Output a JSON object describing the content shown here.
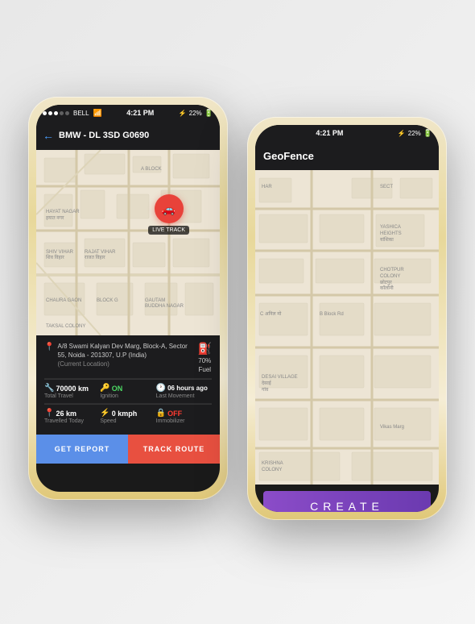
{
  "scene": {
    "background": "#f0f0f0"
  },
  "phone1": {
    "status_bar": {
      "carrier": "BELL",
      "signal_dots": [
        true,
        true,
        true,
        false,
        false
      ],
      "wifi": "wifi",
      "time": "4:21 PM",
      "bluetooth": "BT",
      "battery": "22%"
    },
    "nav": {
      "back_icon": "←",
      "title": "BMW - DL 3SD G0690"
    },
    "map": {
      "live_label": "LIVE TRACK",
      "marker_icon": "🚗"
    },
    "info": {
      "address": "A/8 Swami Kalyan Dev Marg, Block-A, Sector 55, Noida - 201307, U.P (India)",
      "location_label": "(Current Location)",
      "fuel_icon": "⛽",
      "fuel_value": "70%",
      "fuel_label": "Fuel"
    },
    "stats_row1": [
      {
        "icon": "🔧",
        "value": "70000 km",
        "label": "Total Travel"
      },
      {
        "icon": "🔑",
        "value": "ON",
        "label": "Ignition",
        "class": "on"
      },
      {
        "icon": "🕐",
        "value": "06 hours ago",
        "label": "Last Movement"
      }
    ],
    "stats_row2": [
      {
        "icon": "📍",
        "value": "26 km",
        "label": "Travelled Today"
      },
      {
        "icon": "⚡",
        "value": "0 kmph",
        "label": "Speed"
      },
      {
        "icon": "🔒",
        "value": "OFF",
        "label": "Immobilizer",
        "class": "off"
      }
    ],
    "buttons": {
      "report": "GET REPORT",
      "track": "TRACK ROUTE"
    }
  },
  "phone2": {
    "status_bar": {
      "time": "4:21 PM",
      "bluetooth": "BT",
      "battery": "22%"
    },
    "nav": {
      "title": "GeoFence"
    },
    "create_button": "CREATE"
  }
}
